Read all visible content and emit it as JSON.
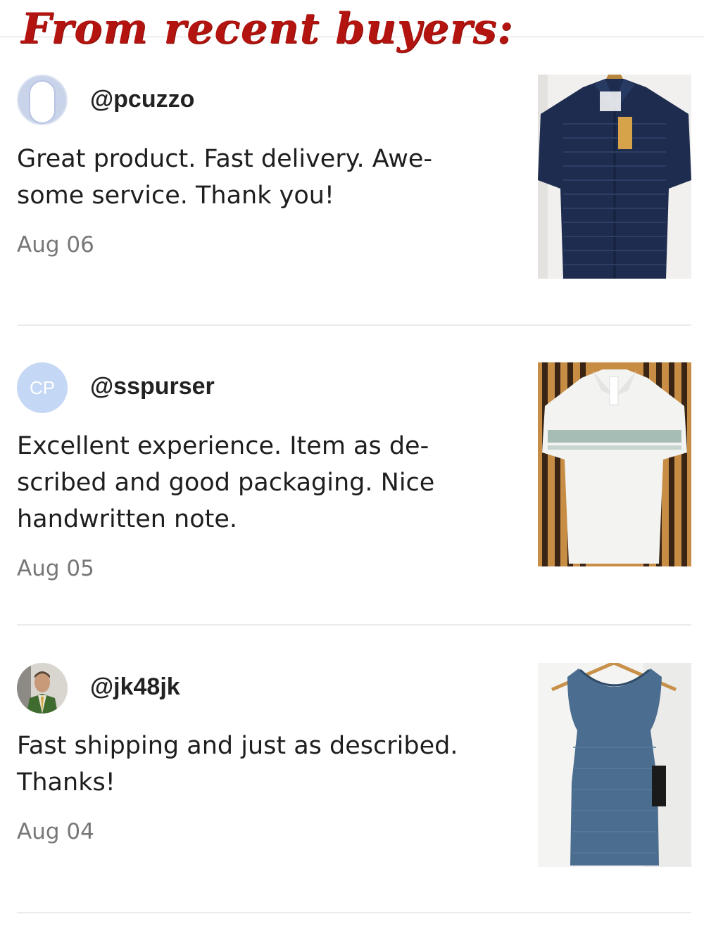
{
  "banner": {
    "title": "From recent buyers:"
  },
  "reviews": [
    {
      "username": "@pcuzzo",
      "avatar": "blank-avatar-icon",
      "comment_lines": [
        "Great product. Fast delivery. Awe-",
        "some service. Thank you!"
      ],
      "date": "Aug 06",
      "item": "navy-short-sleeve-shirt"
    },
    {
      "username": "@sspurser",
      "avatar_initials": "CP",
      "comment_lines": [
        "Excellent experience. Item as de-",
        "scribed and good packaging. Nice",
        "handwritten note."
      ],
      "date": "Aug 05",
      "item": "white-striped-polo-shirt"
    },
    {
      "username": "@jk48jk",
      "avatar": "user-photo",
      "comment_lines": [
        "Fast shipping and just as described.",
        "Thanks!"
      ],
      "date": "Aug 04",
      "item": "blue-tank-top"
    }
  ],
  "colors": {
    "banner_red": "#b4140f",
    "username": "#222222",
    "date_gray": "#777777",
    "divider": "#ececec",
    "initials_avatar": "#c4d7f4"
  }
}
